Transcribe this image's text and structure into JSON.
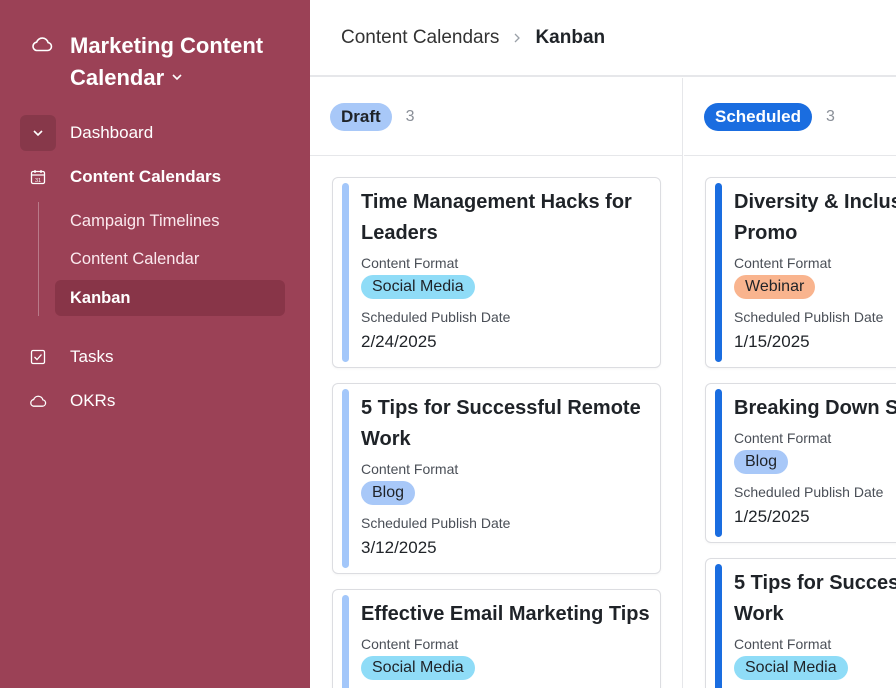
{
  "workspace": {
    "title": "Marketing Content Calendar",
    "icon": "cloud-icon"
  },
  "sidebar": {
    "items": [
      {
        "label": "Dashboard",
        "icon": "chevron-down-icon"
      },
      {
        "label": "Content Calendars",
        "icon": "calendar-icon"
      },
      {
        "label": "Tasks",
        "icon": "checkbox-icon"
      },
      {
        "label": "OKRs",
        "icon": "cloud-icon"
      }
    ],
    "sub_items": [
      {
        "label": "Campaign Timelines"
      },
      {
        "label": "Content Calendar"
      },
      {
        "label": "Kanban"
      }
    ],
    "bg_color": "#9b4156"
  },
  "breadcrumb": {
    "parent": "Content Calendars",
    "current": "Kanban"
  },
  "columns": [
    {
      "name": "Draft",
      "count": "3",
      "pill_color": "#a8c8f8",
      "pill_text_color": "#1f2328",
      "bar_color": "#a3c7fa",
      "cards": [
        {
          "title": "Time Management Hacks for Leaders",
          "format_label": "Content Format",
          "format": "Social Media",
          "format_color": "#8fdcf7",
          "date_label": "Scheduled Publish Date",
          "date": "2/24/2025"
        },
        {
          "title": "5 Tips for Successful Remote Work",
          "format_label": "Content Format",
          "format": "Blog",
          "format_color": "#a8c8f8",
          "date_label": "Scheduled Publish Date",
          "date": "3/12/2025"
        },
        {
          "title": "Effective Email Marketing Tips",
          "format_label": "Content Format",
          "format": "Social Media",
          "format_color": "#8fdcf7"
        }
      ]
    },
    {
      "name": "Scheduled",
      "count": "3",
      "pill_color": "#1a6de0",
      "pill_text_color": "#ffffff",
      "bar_color": "#1a6de0",
      "cards": [
        {
          "title": "Diversity & Inclusion",
          "title_line2": "Promo",
          "format_label": "Content Format",
          "format": "Webinar",
          "format_color": "#f9b48e",
          "date_label": "Scheduled Publish Date",
          "date": "1/15/2025"
        },
        {
          "title": "Breaking Down S",
          "format_label": "Content Format",
          "format": "Blog",
          "format_color": "#a8c8f8",
          "date_label": "Scheduled Publish Date",
          "date": "1/25/2025"
        },
        {
          "title": "5 Tips for Succes",
          "title_line2": "Work",
          "format_label": "Content Format",
          "format": "Social Media",
          "format_color": "#8fdcf7"
        }
      ]
    }
  ]
}
